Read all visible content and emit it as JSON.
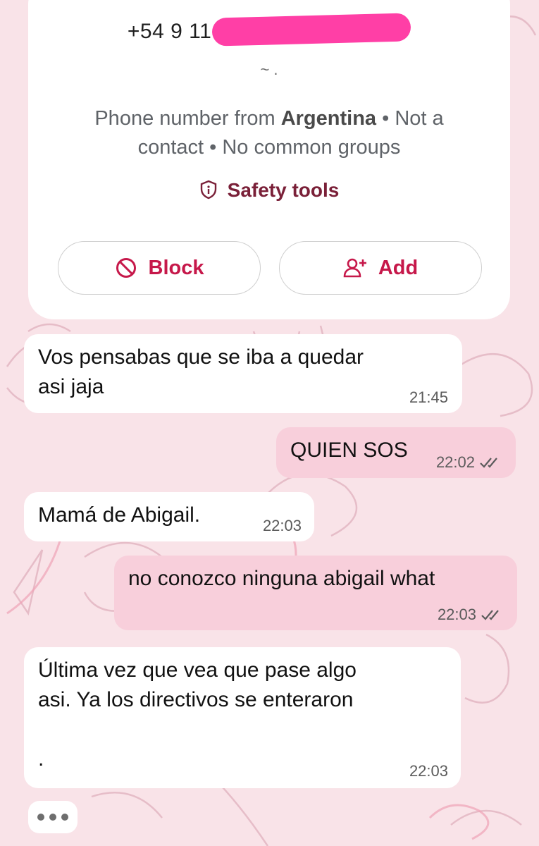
{
  "contact_card": {
    "phone_visible": "+54 9 11",
    "push_name": "~ .",
    "info_prefix": "Phone number from ",
    "country": "Argentina",
    "info_suffix": " • Not a contact • No common groups",
    "safety_label": "Safety tools",
    "block_label": "Block",
    "add_label": "Add"
  },
  "messages": [
    {
      "direction": "in",
      "text": "Vos pensabas que se iba a quedar\nasi jaja",
      "time": "21:45"
    },
    {
      "direction": "out",
      "text": "QUIEN SOS",
      "time": "22:02",
      "status": "read"
    },
    {
      "direction": "in",
      "text": "Mamá de Abigail.",
      "time": "22:03"
    },
    {
      "direction": "out",
      "text": "no conozco ninguna abigail what",
      "time": "22:03",
      "status": "read"
    },
    {
      "direction": "in",
      "text": "Última vez que vea que pase algo\nasi. Ya los directivos se enteraron\n\n.",
      "time": "22:03"
    }
  ],
  "colors": {
    "background": "#f9e3e8",
    "outgoing_bubble": "#f8cfdb",
    "incoming_bubble": "#ffffff",
    "accent": "#c6184a",
    "redaction": "#ff3fa6"
  },
  "icons": [
    "shield-icon",
    "block-icon",
    "add-contact-icon",
    "double-check-icon",
    "typing-dots-icon"
  ]
}
